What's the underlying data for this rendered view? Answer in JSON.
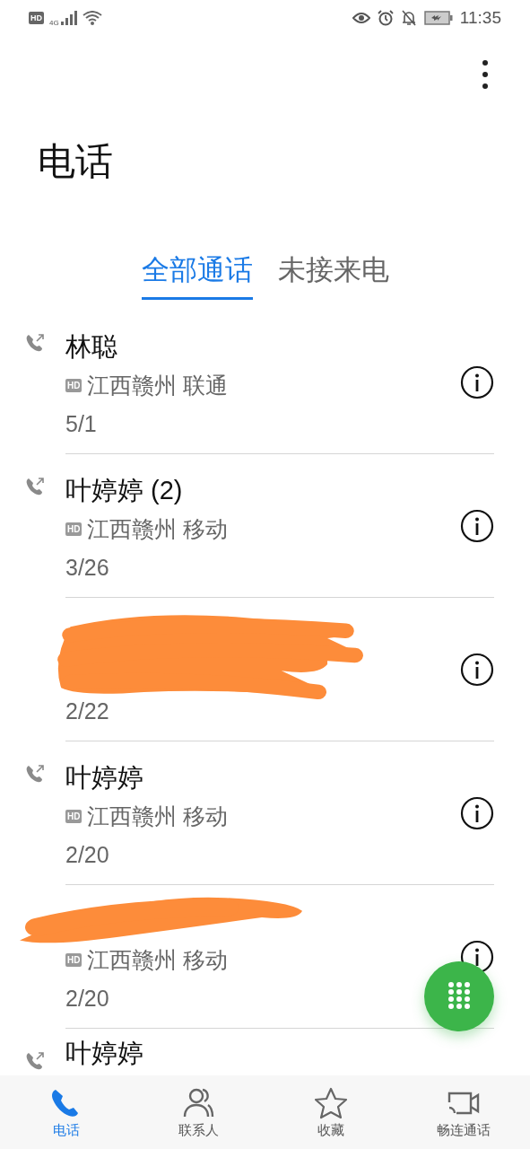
{
  "status_bar": {
    "hd": "HD",
    "network": "4G",
    "time": "11:35"
  },
  "title": "电话",
  "tabs": [
    {
      "label": "全部通话",
      "selected": true
    },
    {
      "label": "未接来电",
      "selected": false
    }
  ],
  "calls": [
    {
      "name": "林聪",
      "hd": "HD",
      "location": "江西赣州 联通",
      "date": "5/1",
      "redacted": false
    },
    {
      "name": "叶婷婷 (2)",
      "hd": "HD",
      "location": "江西赣州 移动",
      "date": "3/26",
      "redacted": false
    },
    {
      "date": "2/22",
      "redacted": true
    },
    {
      "name": "叶婷婷",
      "hd": "HD",
      "location": "江西赣州 移动",
      "date": "2/20",
      "redacted": false
    },
    {
      "hd": "HD",
      "location": "江西赣州 移动",
      "date": "2/20",
      "redacted": true
    },
    {
      "name": "叶婷婷",
      "redacted": false
    }
  ],
  "nav": [
    {
      "label": "电话",
      "selected": true
    },
    {
      "label": "联系人",
      "selected": false
    },
    {
      "label": "收藏",
      "selected": false
    },
    {
      "label": "畅连通话",
      "selected": false
    }
  ]
}
